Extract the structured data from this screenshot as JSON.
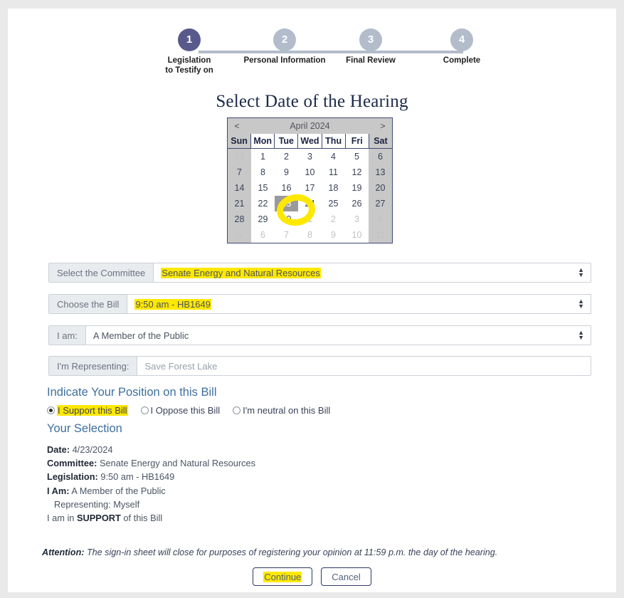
{
  "stepper": {
    "steps": [
      {
        "number": "1",
        "label": "Legislation\nto Testify on",
        "state": "active"
      },
      {
        "number": "2",
        "label": "Personal Information",
        "state": "inactive"
      },
      {
        "number": "3",
        "label": "Final Review",
        "state": "inactive"
      },
      {
        "number": "4",
        "label": "Complete",
        "state": "inactive"
      }
    ]
  },
  "page_title": "Select Date of the Hearing",
  "calendar": {
    "prev_label": "<",
    "next_label": ">",
    "month_label": "April 2024",
    "day_headers": [
      "Sun",
      "Mon",
      "Tue",
      "Wed",
      "Thu",
      "Fri",
      "Sat"
    ],
    "selected_day": "23",
    "weeks": [
      [
        {
          "d": "31",
          "m": "other"
        },
        {
          "d": "1",
          "m": "cur"
        },
        {
          "d": "2",
          "m": "cur"
        },
        {
          "d": "3",
          "m": "cur"
        },
        {
          "d": "4",
          "m": "cur"
        },
        {
          "d": "5",
          "m": "cur"
        },
        {
          "d": "6",
          "m": "cur"
        }
      ],
      [
        {
          "d": "7",
          "m": "cur"
        },
        {
          "d": "8",
          "m": "cur"
        },
        {
          "d": "9",
          "m": "cur"
        },
        {
          "d": "10",
          "m": "cur"
        },
        {
          "d": "11",
          "m": "cur"
        },
        {
          "d": "12",
          "m": "cur"
        },
        {
          "d": "13",
          "m": "cur"
        }
      ],
      [
        {
          "d": "14",
          "m": "cur"
        },
        {
          "d": "15",
          "m": "cur"
        },
        {
          "d": "16",
          "m": "cur"
        },
        {
          "d": "17",
          "m": "cur"
        },
        {
          "d": "18",
          "m": "cur"
        },
        {
          "d": "19",
          "m": "cur"
        },
        {
          "d": "20",
          "m": "cur"
        }
      ],
      [
        {
          "d": "21",
          "m": "cur"
        },
        {
          "d": "22",
          "m": "cur"
        },
        {
          "d": "23",
          "m": "cur",
          "sel": true
        },
        {
          "d": "24",
          "m": "cur"
        },
        {
          "d": "25",
          "m": "cur"
        },
        {
          "d": "26",
          "m": "cur"
        },
        {
          "d": "27",
          "m": "cur"
        }
      ],
      [
        {
          "d": "28",
          "m": "cur"
        },
        {
          "d": "29",
          "m": "cur"
        },
        {
          "d": "30",
          "m": "cur"
        },
        {
          "d": "1",
          "m": "other"
        },
        {
          "d": "2",
          "m": "other"
        },
        {
          "d": "3",
          "m": "other"
        },
        {
          "d": "4",
          "m": "other"
        }
      ],
      [
        {
          "d": "5",
          "m": "other"
        },
        {
          "d": "6",
          "m": "other"
        },
        {
          "d": "7",
          "m": "other"
        },
        {
          "d": "8",
          "m": "other"
        },
        {
          "d": "9",
          "m": "other"
        },
        {
          "d": "10",
          "m": "other"
        },
        {
          "d": "11",
          "m": "other"
        }
      ]
    ]
  },
  "form": {
    "committee": {
      "label": "Select the Committee",
      "value": "Senate Energy and Natural Resources",
      "highlighted": true
    },
    "bill": {
      "label": "Choose the Bill",
      "value": "9:50 am - HB1649",
      "highlighted": true
    },
    "i_am": {
      "label": "I am:",
      "value": "A Member of the Public",
      "highlighted": false
    },
    "representing": {
      "label": "I'm Representing:",
      "value": "Save Forest Lake",
      "is_placeholder": true
    }
  },
  "position": {
    "heading": "Indicate Your Position on this Bill",
    "options": [
      {
        "label": "I Support this Bill",
        "checked": true,
        "highlighted": true
      },
      {
        "label": "I Oppose this Bill",
        "checked": false,
        "highlighted": false
      },
      {
        "label": "I'm neutral on this Bill",
        "checked": false,
        "highlighted": false
      }
    ]
  },
  "summary": {
    "heading": "Your Selection",
    "date_label": "Date:",
    "date_value": "4/23/2024",
    "committee_label": "Committee:",
    "committee_value": "Senate Energy and Natural Resources",
    "legislation_label": "Legislation:",
    "legislation_value": "9:50 am - HB1649",
    "i_am_label": "I Am:",
    "i_am_value": "A Member of the Public",
    "representing_line": "Representing: Myself",
    "position_prefix": "I am in",
    "position_value": "SUPPORT",
    "position_suffix": "of this Bill"
  },
  "attention": {
    "label": "Attention:",
    "text": "The sign-in sheet will close for purposes of registering your opinion at 11:59 p.m. the day of the hearing."
  },
  "buttons": {
    "continue": "Continue",
    "cancel": "Cancel"
  },
  "colors": {
    "step_active": "#585a8c",
    "step_inactive": "#b3bcca",
    "highlight": "#ffe800",
    "title": "#1b2a4a",
    "section_heading": "#3e6f9e",
    "button_border": "#2b3a6b"
  }
}
